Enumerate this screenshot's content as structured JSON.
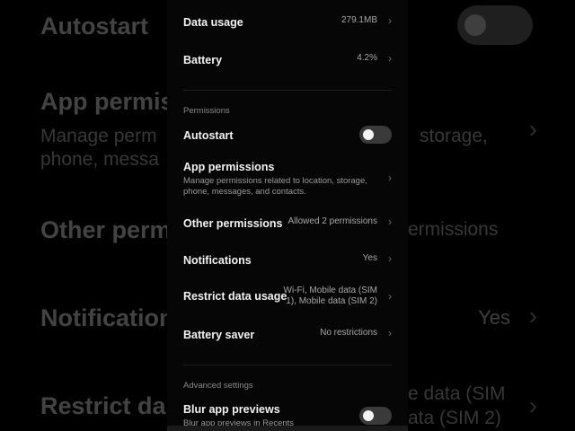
{
  "background": {
    "autostart": "Autostart",
    "app_permissions": "App permis",
    "app_permissions_desc_l1": "Manage perm",
    "app_permissions_desc_r1": "storage,",
    "app_permissions_desc_l2": "phone, messa",
    "other_permissions": "Other perm",
    "other_permissions_value": "ermissions",
    "notifications": "Notification",
    "notifications_value": "Yes",
    "restrict_data": "Restrict da",
    "restrict_data_value_l1": "e data (SIM",
    "restrict_data_value_l2": "ata (SIM 2)"
  },
  "usage": {
    "data_usage": {
      "label": "Data usage",
      "value": "279.1MB"
    },
    "battery": {
      "label": "Battery",
      "value": "4.2%"
    }
  },
  "permissions": {
    "section_label": "Permissions",
    "autostart": {
      "label": "Autostart",
      "enabled": false
    },
    "app_permissions": {
      "label": "App permissions",
      "description_line1": "Manage permissions related to location, storage,",
      "description_line2": "phone, messages, and contacts."
    },
    "other_permissions": {
      "label": "Other permissions",
      "value": "Allowed 2 permissions"
    },
    "notifications": {
      "label": "Notifications",
      "value": "Yes"
    },
    "restrict_data_usage": {
      "label": "Restrict data usage",
      "value_line1": "Wi-Fi, Mobile data (SIM",
      "value_line2": "1), Mobile data (SIM 2)"
    },
    "battery_saver": {
      "label": "Battery saver",
      "value": "No restrictions"
    }
  },
  "advanced": {
    "section_label": "Advanced settings",
    "blur_app_previews": {
      "label": "Blur app previews",
      "description": "Blur app previews in Recents",
      "enabled": false
    }
  },
  "icons": {
    "chevron": "chevron-right-icon"
  },
  "colors": {
    "background": "#000000",
    "panel": "#060606",
    "text": "#f2f2f2",
    "secondary": "#a8a8a8",
    "toggle_off": "#3a3a3a"
  }
}
